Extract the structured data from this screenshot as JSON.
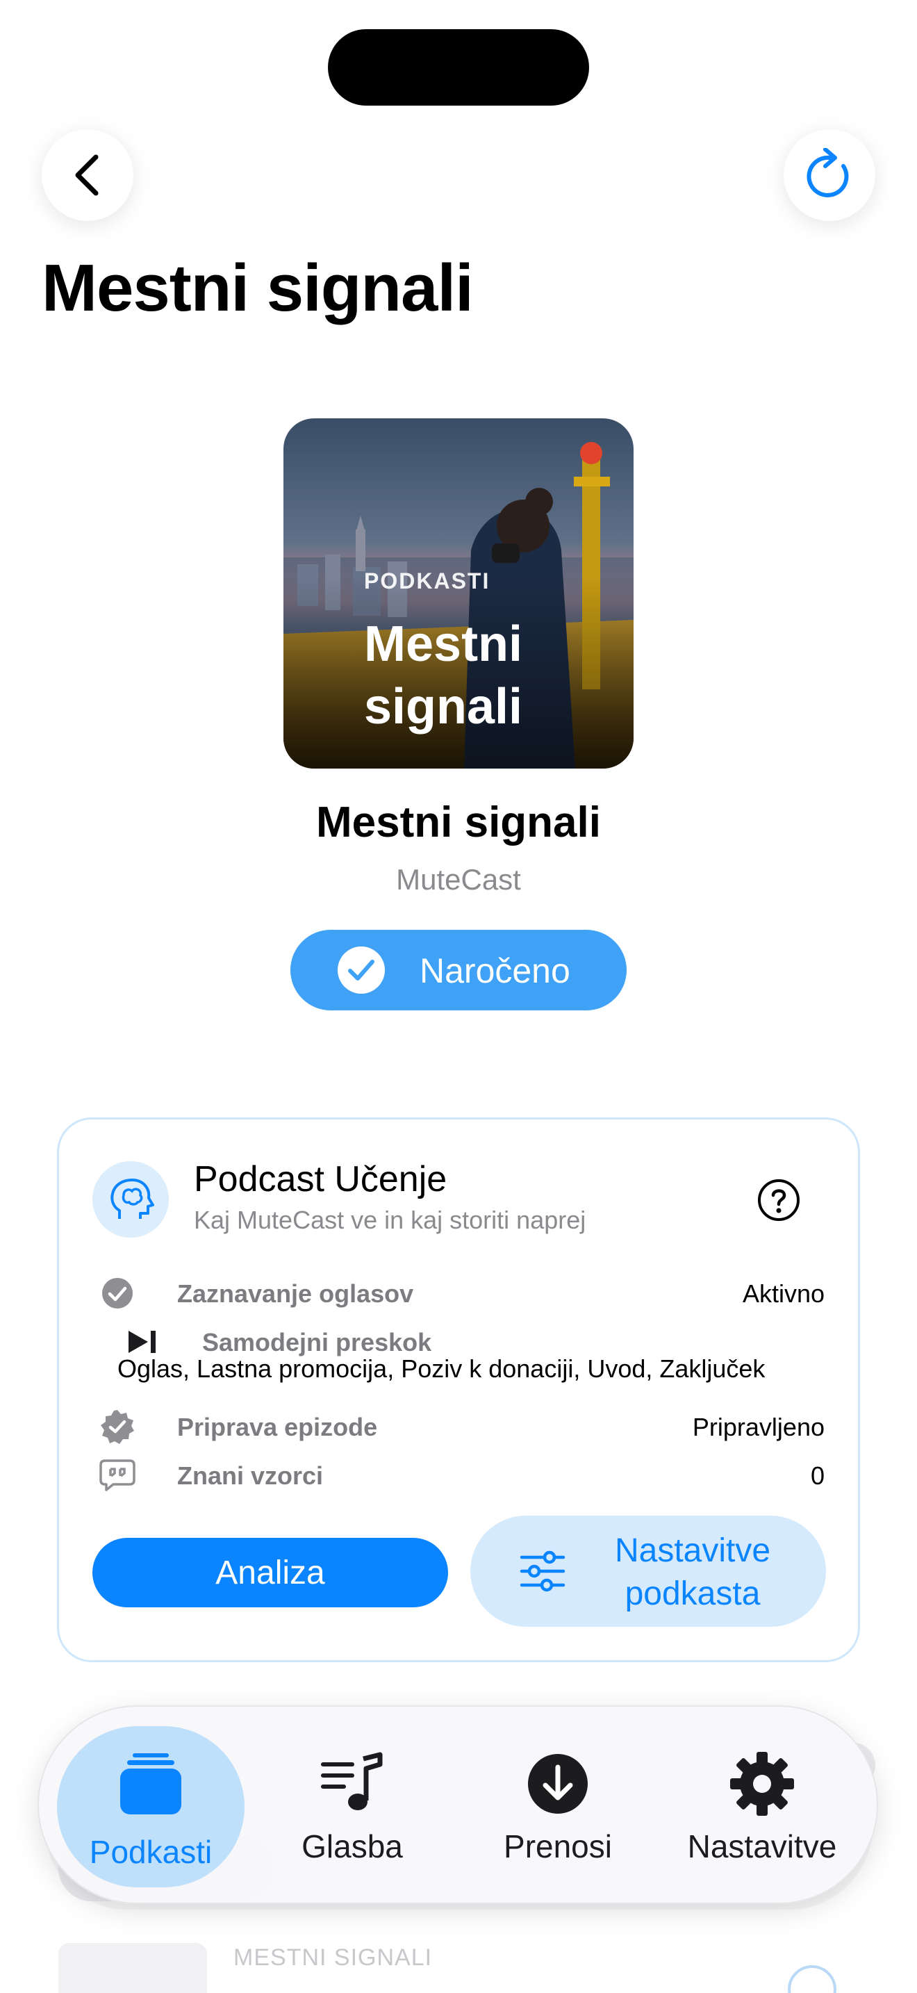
{
  "header": {
    "title": "Mestni signali",
    "back_icon": "chevron-left-icon",
    "refresh_icon": "refresh-icon"
  },
  "podcast": {
    "cover_kicker": "PODKASTI",
    "cover_title": "Mestni signali",
    "title": "Mestni signali",
    "author": "MuteCast",
    "subscribe_label": "Naročeno"
  },
  "learning": {
    "title": "Podcast Učenje",
    "subtitle": "Kaj MuteCast ve in kaj storiti naprej",
    "rows": [
      {
        "icon": "check-circle-icon",
        "label": "Zaznavanje oglasov",
        "value": "Aktivno"
      },
      {
        "icon": "skip-forward-icon",
        "label": "Samodejni preskok",
        "value": "Oglas, Lastna promocija, Poziv k donaciji, Uvod, Zaključek"
      },
      {
        "icon": "verified-badge-icon",
        "label": "Priprava epizode",
        "value": "Pripravljeno"
      },
      {
        "icon": "quote-bubble-icon",
        "label": "Znani vzorci",
        "value": "0"
      }
    ],
    "analyze_label": "Analiza",
    "settings_label": "Nastavitve podkasta"
  },
  "background_peek": {
    "text": "MESTNI SIGNALI"
  },
  "tabbar": {
    "tabs": [
      {
        "label": "Podkasti",
        "icon": "podcasts-stack-icon",
        "active": true
      },
      {
        "label": "Glasba",
        "icon": "music-list-icon",
        "active": false
      },
      {
        "label": "Prenosi",
        "icon": "download-circle-icon",
        "active": false
      },
      {
        "label": "Nastavitve",
        "icon": "gear-icon",
        "active": false
      }
    ]
  },
  "colors": {
    "accent": "#0a84ff",
    "subscribe_bg": "#3fa2f6",
    "card_border": "#cfe6fb",
    "settings_btn_bg": "#d5ebfd"
  }
}
